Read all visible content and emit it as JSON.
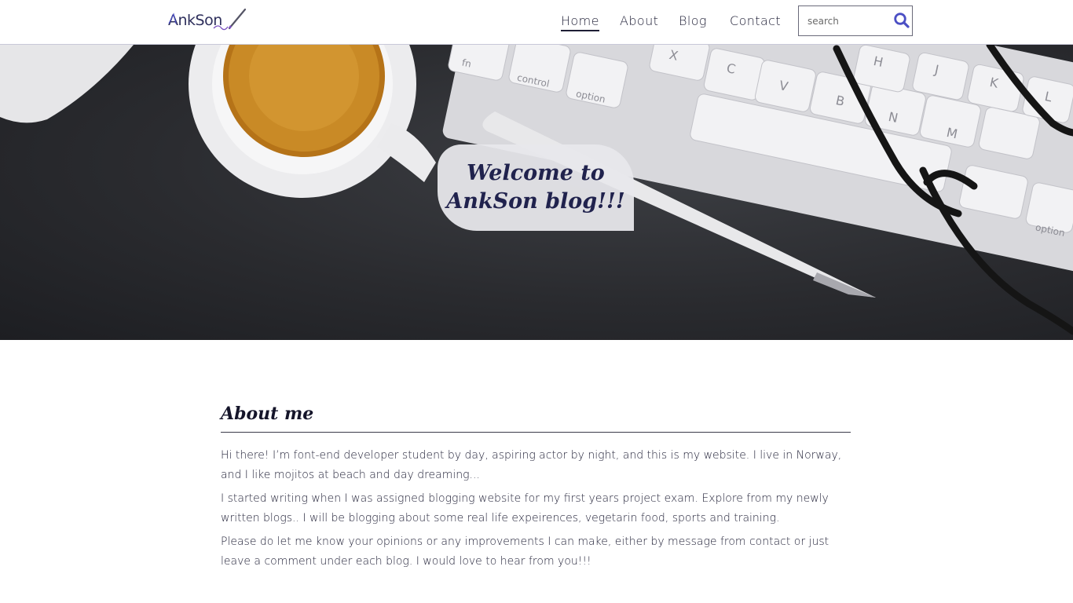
{
  "header": {
    "logo_text": "AnkSon",
    "nav": [
      {
        "label": "Home",
        "active": true
      },
      {
        "label": "About",
        "active": false
      },
      {
        "label": "Blog",
        "active": false
      },
      {
        "label": "Contact",
        "active": false
      }
    ],
    "search": {
      "placeholder": "search",
      "value": "",
      "icon": "search-icon"
    }
  },
  "hero": {
    "welcome_line1": "Welcome to",
    "welcome_line2": "AnkSon blog!!!",
    "keyboard_keys": [
      "fn",
      "control",
      "option",
      "X",
      "C",
      "V",
      "B",
      "N",
      "M",
      "H",
      "J",
      "K",
      "L",
      "option"
    ]
  },
  "about": {
    "title": "About me",
    "paragraphs": [
      "Hi there! I’m font-end developer student by day, aspiring actor by night, and this is my website. I live in Norway, and I like mojitos at beach and day dreaming...",
      "I started writing when I was assigned blogging website for my first years project exam. Explore from my newly written blogs.. I will be blogging about some real life expeirences, vegetarin food, sports and training.",
      "Please do let me know your opinions or any improvements I can make, either by message from contact or just leave a comment under each blog. I would love to hear from you!!!"
    ]
  },
  "colors": {
    "accent": "#4b4fc4",
    "brand_dark": "#20224d",
    "hero_bg": "#2a2b2f"
  }
}
